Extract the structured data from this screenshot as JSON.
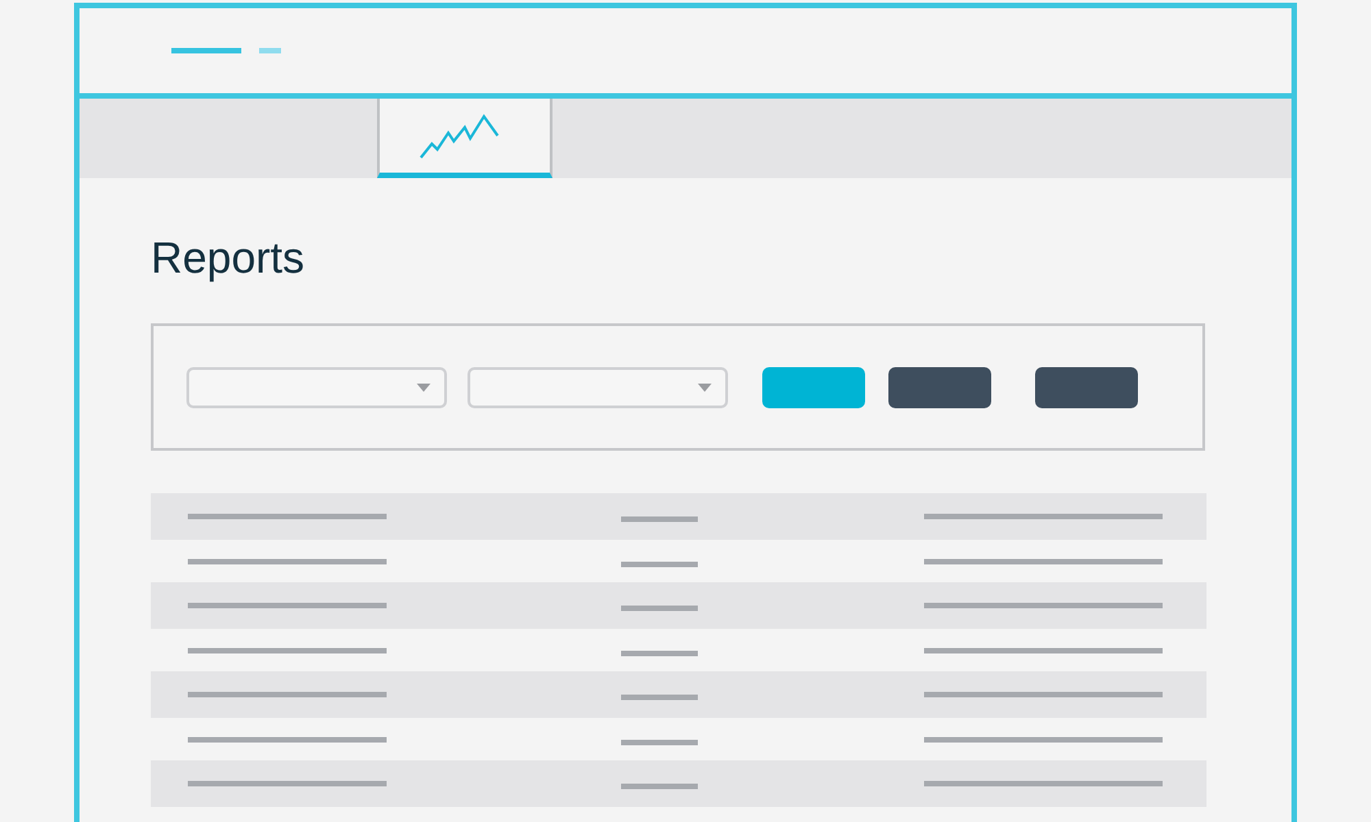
{
  "header": {
    "marks": [
      {
        "kind": "long"
      },
      {
        "kind": "short"
      }
    ]
  },
  "tabs": [
    {
      "kind": "chart",
      "selected": true
    }
  ],
  "page": {
    "title": "Reports"
  },
  "filter_panel": {
    "dropdowns": [
      {
        "kind": "dropdown"
      },
      {
        "kind": "dropdown"
      }
    ],
    "buttons": [
      {
        "kind": "primary"
      },
      {
        "kind": "secondary"
      },
      {
        "kind": "secondary"
      }
    ]
  },
  "table": {
    "rows": [
      {
        "kind": "placeholder"
      },
      {
        "kind": "placeholder"
      },
      {
        "kind": "placeholder"
      },
      {
        "kind": "placeholder"
      },
      {
        "kind": "placeholder"
      },
      {
        "kind": "placeholder"
      },
      {
        "kind": "placeholder"
      }
    ]
  }
}
